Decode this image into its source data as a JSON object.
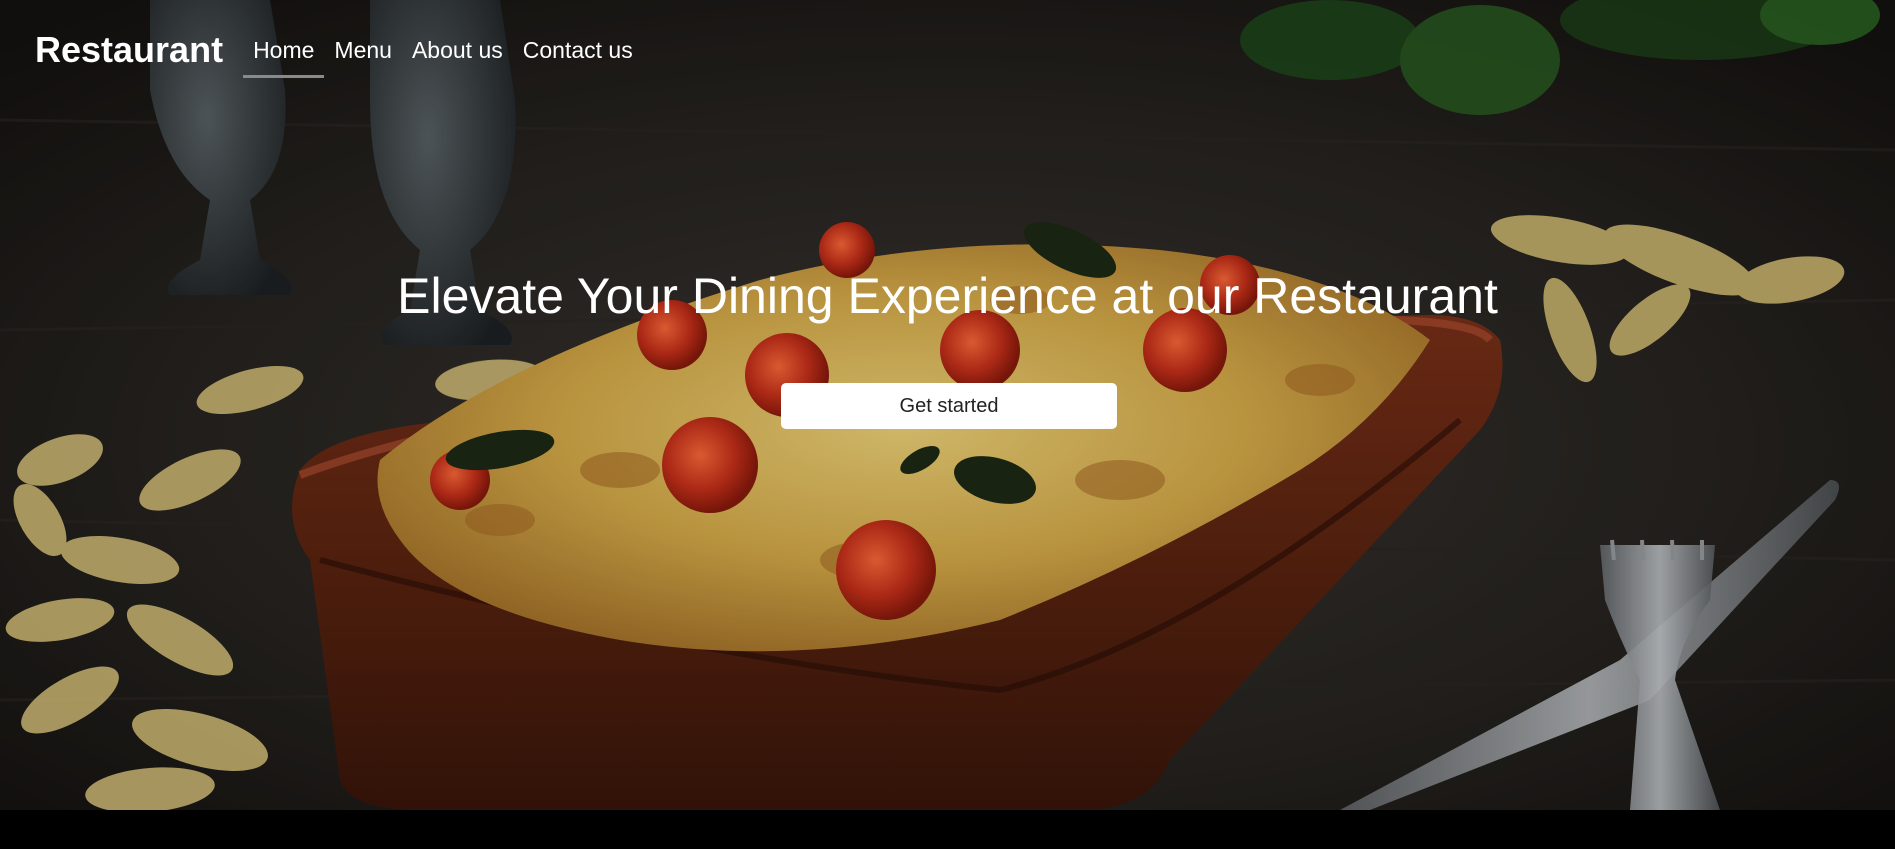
{
  "nav": {
    "brand": "Restaurant",
    "links": [
      {
        "label": "Home",
        "active": true
      },
      {
        "label": "Menu",
        "active": false
      },
      {
        "label": "About us",
        "active": false
      },
      {
        "label": "Contact us",
        "active": false
      }
    ]
  },
  "hero": {
    "headline": "Elevate Your Dining Experience at our Restaurant",
    "cta_label": "Get started",
    "image_subject": "baked pasta with cherry tomatoes in clay dish"
  },
  "colors": {
    "text": "#ffffff",
    "active_underline": "#8a8a8a",
    "button_bg": "#ffffff",
    "button_text": "#222222"
  }
}
